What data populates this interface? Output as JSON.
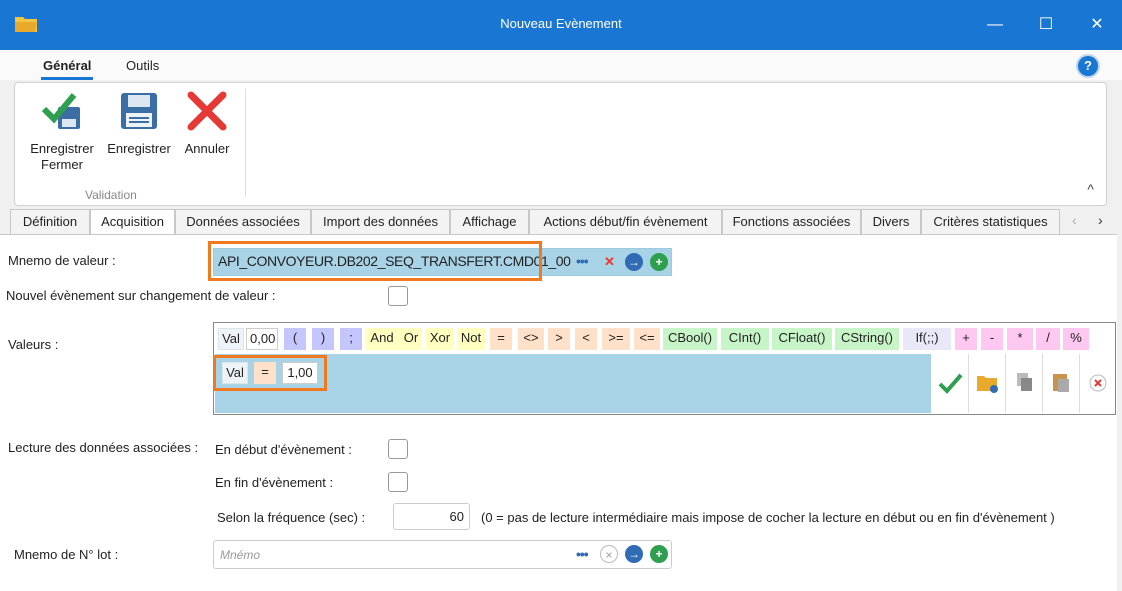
{
  "window": {
    "title": "Nouveau Evènement",
    "app_icon": "folder-icon",
    "controls": {
      "minimize": "—",
      "maximize": "☐",
      "close": "✕"
    }
  },
  "ribbon": {
    "tabs": [
      "Général",
      "Outils"
    ],
    "help": "?",
    "buttons": [
      {
        "label_line1": "Enregistrer",
        "label_line2": "Fermer",
        "icon": "save-close-icon"
      },
      {
        "label_line1": "Enregistrer",
        "label_line2": "",
        "icon": "floppy-disk-icon"
      },
      {
        "label_line1": "Annuler",
        "label_line2": "",
        "icon": "cancel-x-icon"
      }
    ],
    "group_label": "Validation",
    "collapse": "^"
  },
  "tabs": [
    "Définition",
    "Acquisition",
    "Données associées",
    "Import des données",
    "Affichage",
    "Actions début/fin évènement",
    "Fonctions associées",
    "Divers",
    "Critères statistiques"
  ],
  "tab_nav": {
    "prev": "‹",
    "next": "›"
  },
  "form": {
    "mnemo_label": "Mnemo de valeur :",
    "mnemo_value": "API_CONVOYEUR.DB202_SEQ_TRANSFERT.CMD01_00",
    "mnemo_dots": "•••",
    "mnemo_clear": "✕",
    "new_event_label": "Nouvel évènement sur changement de valeur :",
    "values_label": "Valeurs :",
    "tokens": [
      "Val",
      "0,00",
      "(",
      ")",
      ";",
      "And",
      "Or",
      "Xor",
      "Not",
      "=",
      "<>",
      ">",
      "<",
      ">=",
      "<=",
      "CBool()",
      "CInt()",
      "CFloat()",
      "CString()",
      "If(;;)",
      "+",
      "-",
      "*",
      "/",
      "%"
    ],
    "expression": [
      "Val",
      "=",
      "1,00"
    ],
    "read_label": "Lecture des données associées :",
    "read_start_label": "En début d'évènement :",
    "read_end_label": "En fin d'évènement :",
    "freq_label": "Selon la fréquence (sec) :",
    "freq_value": "60",
    "freq_note": "(0 = pas de lecture intermédiaire mais impose de cocher la lecture en début ou en fin d'évènement )",
    "lot_label": "Mnemo de N° lot :",
    "lot_placeholder": "Mnémo",
    "lot_dots": "•••"
  },
  "colors": {
    "titlebar": "#1976d2",
    "highlight": "#f07a1f",
    "value_bg": "#a8d3e6",
    "confirm": "#2e9e4f",
    "clear": "#e53935"
  }
}
